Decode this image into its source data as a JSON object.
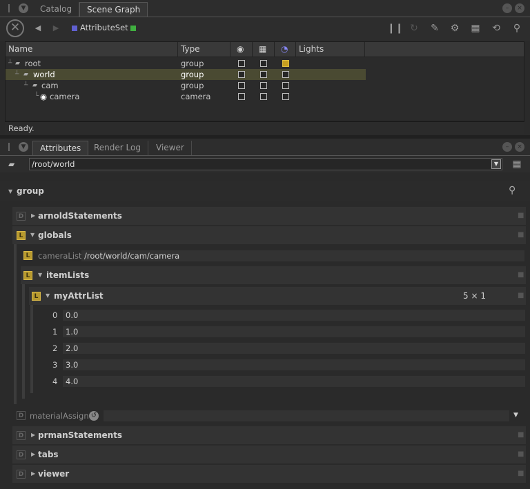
{
  "top_panel": {
    "tabs": [
      {
        "label": "Catalog"
      },
      {
        "label": "Scene Graph"
      }
    ],
    "active_tab": 1
  },
  "scene_toolbar": {
    "attribute_set_label": "AttributeSet",
    "swatch_left_color": "#6060d0",
    "swatch_right_color": "#40b040"
  },
  "scene_graph": {
    "columns": {
      "name": "Name",
      "type": "Type",
      "lights": "Lights"
    },
    "rows": [
      {
        "name": "root",
        "type": "group",
        "light_checked": true
      },
      {
        "name": "world",
        "type": "group",
        "selected": true
      },
      {
        "name": "cam",
        "type": "group"
      },
      {
        "name": "camera",
        "type": "camera"
      }
    ]
  },
  "status": {
    "text": "Ready."
  },
  "bottom_panel": {
    "tabs": [
      {
        "label": "Attributes"
      },
      {
        "label": "Render Log"
      },
      {
        "label": "Viewer"
      }
    ],
    "active_tab": 0
  },
  "attributes": {
    "path": "/root/world",
    "group_label": "group",
    "arnold": {
      "badge": "D",
      "label": "arnoldStatements"
    },
    "globals": {
      "badge": "L",
      "label": "globals"
    },
    "camera_list": {
      "badge": "L",
      "label": "cameraList",
      "value": "/root/world/cam/camera"
    },
    "item_lists": {
      "badge": "L",
      "label": "itemLists"
    },
    "my_attr_list": {
      "badge": "L",
      "label": "myAttrList",
      "dims": "5 × 1"
    },
    "list_items": [
      {
        "index": "0",
        "value": "0.0"
      },
      {
        "index": "1",
        "value": "1.0"
      },
      {
        "index": "2",
        "value": "2.0"
      },
      {
        "index": "3",
        "value": "3.0"
      },
      {
        "index": "4",
        "value": "4.0"
      }
    ],
    "material_assign": {
      "badge": "D",
      "label": "materialAssign"
    },
    "prman": {
      "badge": "D",
      "label": "prmanStatements"
    },
    "tabs_section": {
      "badge": "D",
      "label": "tabs"
    },
    "viewer_section": {
      "badge": "D",
      "label": "viewer"
    }
  }
}
